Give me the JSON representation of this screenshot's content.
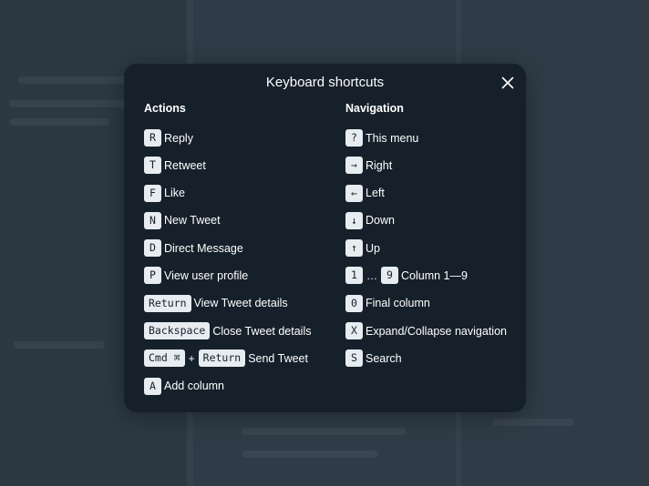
{
  "colors": {
    "modal_bg": "#15202b",
    "key_bg": "#e6ecf0",
    "backdrop": "#2f3c47"
  },
  "modal": {
    "title": "Keyboard shortcuts",
    "close_icon": "close-icon"
  },
  "actions": {
    "heading": "Actions",
    "items": [
      {
        "keys": [
          "R"
        ],
        "label": "Reply"
      },
      {
        "keys": [
          "T"
        ],
        "label": "Retweet"
      },
      {
        "keys": [
          "F"
        ],
        "label": "Like"
      },
      {
        "keys": [
          "N"
        ],
        "label": "New Tweet"
      },
      {
        "keys": [
          "D"
        ],
        "label": "Direct Message"
      },
      {
        "keys": [
          "P"
        ],
        "label": "View user profile"
      },
      {
        "keys": [
          "Return"
        ],
        "label": "View Tweet details"
      },
      {
        "keys": [
          "Backspace"
        ],
        "label": "Close Tweet details"
      },
      {
        "keys": [
          "Cmd ⌘",
          "Return"
        ],
        "joiner": "+",
        "label": "Send Tweet"
      },
      {
        "keys": [
          "A"
        ],
        "label": "Add column"
      }
    ]
  },
  "navigation": {
    "heading": "Navigation",
    "items": [
      {
        "keys": [
          "?"
        ],
        "label": "This menu"
      },
      {
        "keys": [
          "→"
        ],
        "label": "Right"
      },
      {
        "keys": [
          "←"
        ],
        "label": "Left"
      },
      {
        "keys": [
          "↓"
        ],
        "label": "Down"
      },
      {
        "keys": [
          "↑"
        ],
        "label": "Up"
      },
      {
        "keys": [
          "1",
          "9"
        ],
        "joiner": "…",
        "label": "Column 1—9"
      },
      {
        "keys": [
          "0"
        ],
        "label": "Final column"
      },
      {
        "keys": [
          "X"
        ],
        "label": "Expand/Collapse navigation"
      },
      {
        "keys": [
          "S"
        ],
        "label": "Search"
      }
    ]
  }
}
